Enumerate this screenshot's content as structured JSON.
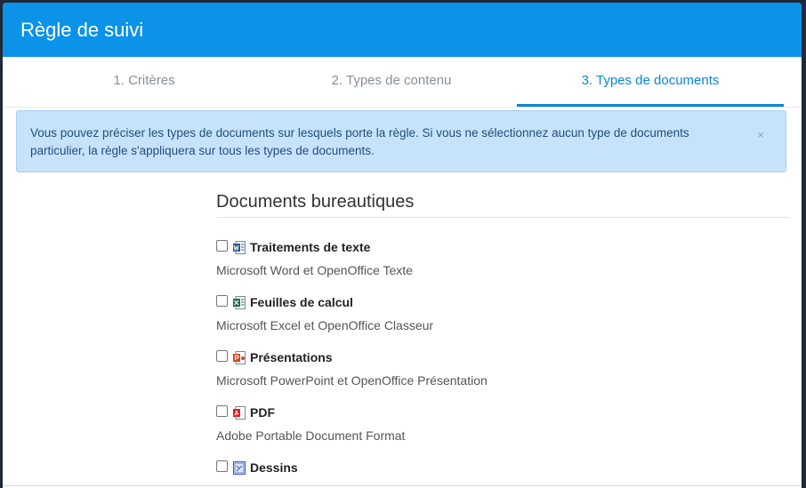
{
  "modal": {
    "title": "Règle de suivi"
  },
  "tabs": [
    {
      "label": "1. Critères",
      "active": false
    },
    {
      "label": "2. Types de contenu",
      "active": false
    },
    {
      "label": "3. Types de documents",
      "active": true
    }
  ],
  "alert": {
    "text": "Vous pouvez préciser les types de documents sur lesquels porte la règle. Si vous ne sélectionnez aucun type de documents particulier, la règle s'appliquera sur tous les types de documents.",
    "close_symbol": "×"
  },
  "section": {
    "title": "Documents bureautiques"
  },
  "documents": [
    {
      "label": "Traitements de texte",
      "description": "Microsoft Word et OpenOffice Texte",
      "icon": "word-icon",
      "color": "#2b5797"
    },
    {
      "label": "Feuilles de calcul",
      "description": "Microsoft Excel et OpenOffice Classeur",
      "icon": "excel-icon",
      "color": "#1e7145"
    },
    {
      "label": "Présentations",
      "description": "Microsoft PowerPoint et OpenOffice Présentation",
      "icon": "powerpoint-icon",
      "color": "#d24726"
    },
    {
      "label": "PDF",
      "description": "Adobe Portable Document Format",
      "icon": "pdf-icon",
      "color": "#e02020"
    },
    {
      "label": "Dessins",
      "description": "",
      "icon": "drawing-icon",
      "color": "#3b5fb8"
    }
  ],
  "colors": {
    "header": "#0a93e8",
    "active_tab": "#0a86d8",
    "alert_bg": "#c7e2fb"
  }
}
